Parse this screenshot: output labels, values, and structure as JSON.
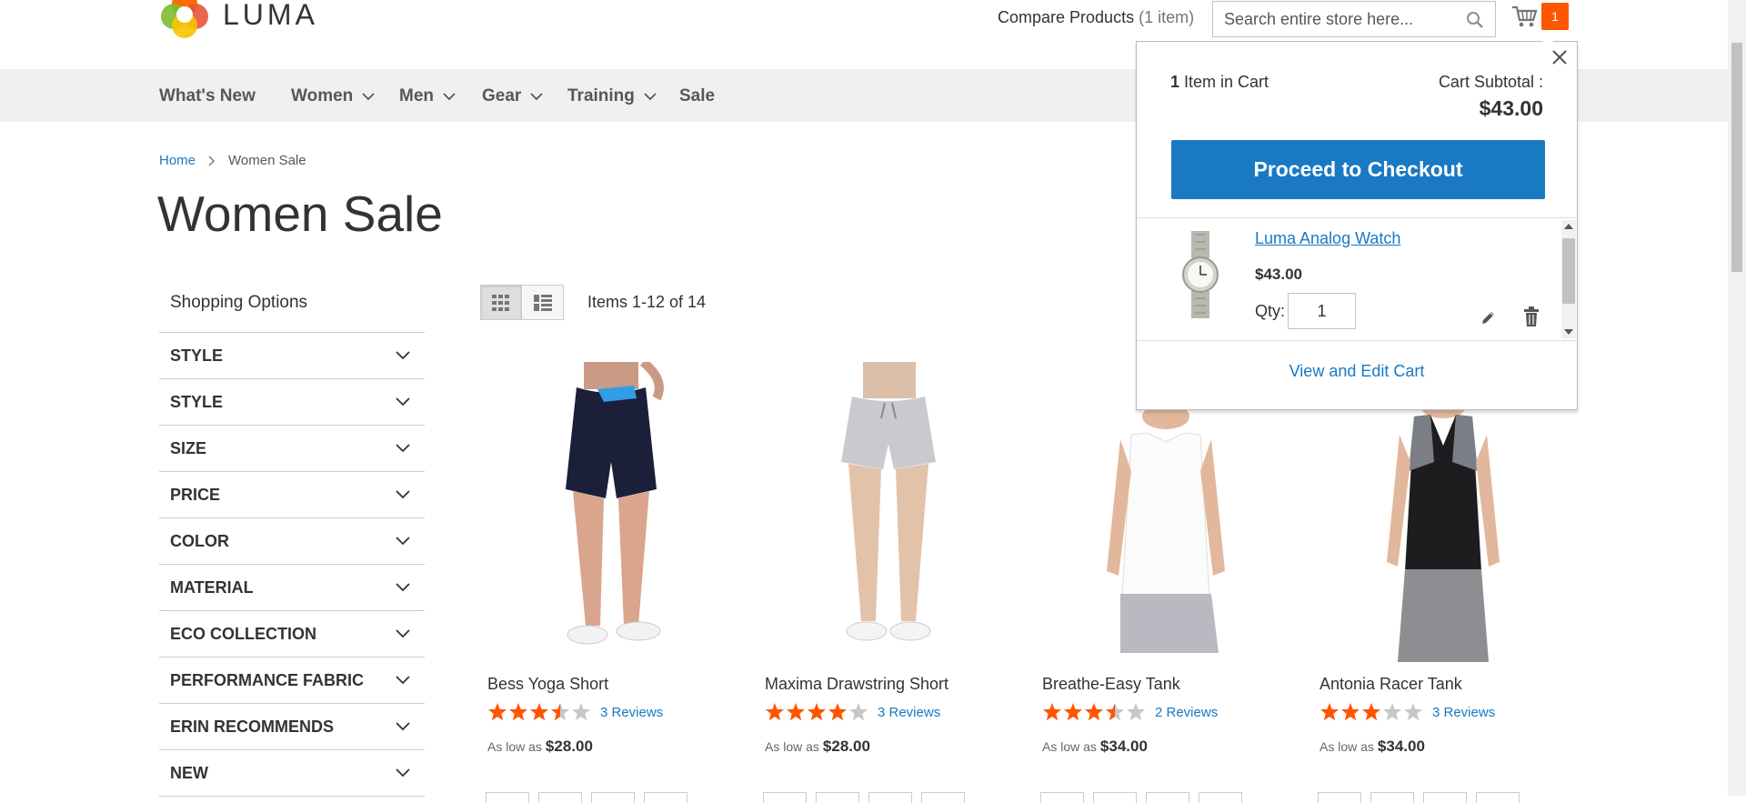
{
  "header": {
    "logo_text": "LUMA",
    "compare_label": "Compare Products",
    "compare_count": "(1 item)",
    "search_placeholder": "Search entire store here...",
    "cart_counter": "1"
  },
  "nav": {
    "items": [
      {
        "label": "What's New",
        "has_dropdown": false
      },
      {
        "label": "Women",
        "has_dropdown": true
      },
      {
        "label": "Men",
        "has_dropdown": true
      },
      {
        "label": "Gear",
        "has_dropdown": true
      },
      {
        "label": "Training",
        "has_dropdown": true
      },
      {
        "label": "Sale",
        "has_dropdown": false
      }
    ]
  },
  "breadcrumb": {
    "home": "Home",
    "current": "Women Sale"
  },
  "page_title": "Women Sale",
  "sidebar": {
    "title": "Shopping Options",
    "filters": [
      "STYLE",
      "STYLE",
      "SIZE",
      "PRICE",
      "COLOR",
      "MATERIAL",
      "ECO COLLECTION",
      "PERFORMANCE FABRIC",
      "ERIN RECOMMENDS",
      "NEW"
    ]
  },
  "toolbar": {
    "amount": "Items 1-12 of 14"
  },
  "products": [
    {
      "name": "Bess Yoga Short",
      "rating": 3.5,
      "reviews": "3 Reviews",
      "price_prefix": "As low as",
      "price": "$28.00"
    },
    {
      "name": "Maxima Drawstring Short",
      "rating": 4,
      "reviews": "3 Reviews",
      "price_prefix": "As low as",
      "price": "$28.00"
    },
    {
      "name": "Breathe-Easy Tank",
      "rating": 3.5,
      "reviews": "2 Reviews",
      "price_prefix": "As low as",
      "price": "$34.00"
    },
    {
      "name": "Antonia Racer Tank",
      "rating": 3,
      "reviews": "3 Reviews",
      "price_prefix": "As low as",
      "price": "$34.00"
    }
  ],
  "minicart": {
    "count": "1",
    "count_label": "Item in Cart",
    "subtotal_label": "Cart Subtotal :",
    "subtotal": "$43.00",
    "checkout_label": "Proceed to Checkout",
    "item_name": "Luma Analog Watch",
    "item_price": "$43.00",
    "qty_label": "Qty:",
    "qty_value": "1",
    "view_cart_label": "View and Edit Cart"
  },
  "colors": {
    "accent": "#1979c3",
    "star": "#ff5501",
    "nav_bg": "#f0f0f0"
  }
}
